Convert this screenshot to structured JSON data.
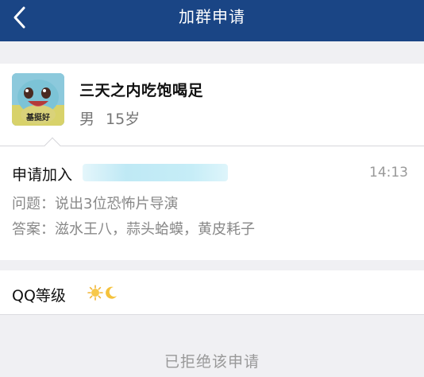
{
  "navbar": {
    "title": "加群申请",
    "back_icon": "chevron-left-icon",
    "background": "#1a4585"
  },
  "profile": {
    "avatar_caption": "基挺好",
    "nickname": "三天之内吃饱喝足",
    "gender": "男",
    "age": "15岁"
  },
  "request": {
    "label": "申请加入",
    "time": "14:13",
    "question": "问题：说出3位恐怖片导演",
    "answer": "答案：滋水王八，蒜头蛤蟆，黄皮耗子"
  },
  "level": {
    "label": "QQ等级",
    "icons": [
      "sun-icon",
      "moon-icon"
    ]
  },
  "status": {
    "text": "已拒绝该申请"
  }
}
